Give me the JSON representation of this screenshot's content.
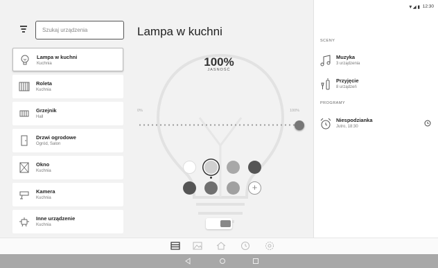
{
  "search": {
    "placeholder": "Szukaj urządzenia"
  },
  "devices": [
    {
      "name": "Lampa w kuchni",
      "room": "Kuchnia",
      "icon": "lightbulb-icon"
    },
    {
      "name": "Roleta",
      "room": "Kuchnia",
      "icon": "blinds-icon"
    },
    {
      "name": "Grzejnik",
      "room": "Hall",
      "icon": "radiator-icon"
    },
    {
      "name": "Drzwi ogrodowe",
      "room": "Ogród, Salon",
      "icon": "door-icon"
    },
    {
      "name": "Okno",
      "room": "Kuchnia",
      "icon": "window-icon"
    },
    {
      "name": "Kamera",
      "room": "Kuchnia",
      "icon": "camera-icon"
    },
    {
      "name": "Inne urządzenie",
      "room": "Kuchnia",
      "icon": "robot-icon"
    }
  ],
  "detail": {
    "title": "Lampa w kuchni",
    "brightness": "100%",
    "brightness_label": "JASNOŚĆ",
    "slider_min": "0%",
    "slider_max": "100%",
    "slider_value": 1.0,
    "power_on": true
  },
  "colors": [
    "#ffffff",
    "#d0d0d0",
    "#a8a8a8",
    "#555555",
    "#555555",
    "#707070",
    "#a0a0a0"
  ],
  "selected_color_index": 1,
  "status_bar": {
    "time": "12:30",
    "icons": "▼◢ ▮"
  },
  "scenes": {
    "title": "SCENY",
    "items": [
      {
        "name": "Muzyka",
        "sub": "3 urządzenia",
        "icon": "music-icon"
      },
      {
        "name": "Przyjęcie",
        "sub": "8 urządzeń",
        "icon": "party-icon"
      }
    ]
  },
  "programs": {
    "title": "PROGRAMY",
    "items": [
      {
        "name": "Niespodzianka",
        "sub": "Jutro, 18:30",
        "icon": "alarm-clock-icon"
      }
    ]
  },
  "bottom_tabs": [
    "devices-icon",
    "image-icon",
    "home-icon",
    "clock-icon",
    "settings-icon"
  ]
}
